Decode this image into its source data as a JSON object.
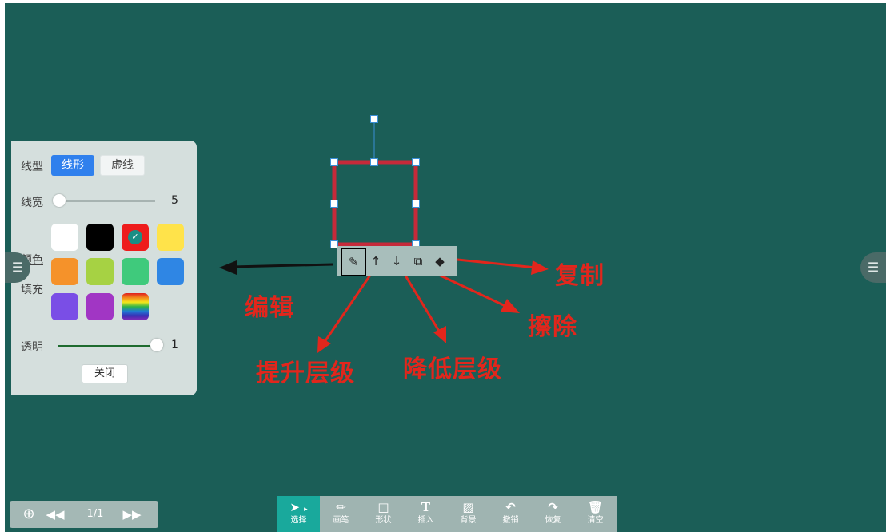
{
  "panel": {
    "line_type_label": "线型",
    "solid_label": "线形",
    "dash_label": "虚线",
    "line_width_label": "线宽",
    "line_width_value": "5",
    "color_label": "颜色",
    "fill_label": "填充",
    "opacity_label": "透明",
    "opacity_value": "1",
    "close_label": "关闭",
    "selected_color": "red",
    "swatches": [
      "#ffffff",
      "#000000",
      "#ee1c1c",
      "#ffe34a",
      "#f5922a",
      "#a6d243",
      "#3fca7c",
      "#2f86e4",
      "#7a4ee6",
      "#a136c4",
      "rainbow"
    ]
  },
  "annotations": {
    "edit": "编辑",
    "copy": "复制",
    "erase": "擦除",
    "raise_layer": "提升层级",
    "lower_layer": "降低层级"
  },
  "shape_toolbar": {
    "icons": [
      "edit-icon",
      "arrow-up-icon",
      "arrow-down-icon",
      "copy-icon",
      "eraser-icon"
    ]
  },
  "page_nav": {
    "page_indicator": "1/1"
  },
  "toolbar": {
    "tools": [
      {
        "label": "选择",
        "icon": "cursor-icon",
        "active": true
      },
      {
        "label": "画笔",
        "icon": "pen-icon"
      },
      {
        "label": "形状",
        "icon": "shape-icon"
      },
      {
        "label": "插入",
        "icon": "text-icon"
      },
      {
        "label": "背景",
        "icon": "background-icon"
      },
      {
        "label": "撤销",
        "icon": "undo-icon"
      },
      {
        "label": "恢复",
        "icon": "redo-icon"
      },
      {
        "label": "清空",
        "icon": "trash-icon"
      }
    ]
  },
  "colors": {
    "canvas": "#1b5e57",
    "accent": "#2f80ed",
    "annotation": "#e2261c",
    "active_tool": "#19a99c"
  }
}
